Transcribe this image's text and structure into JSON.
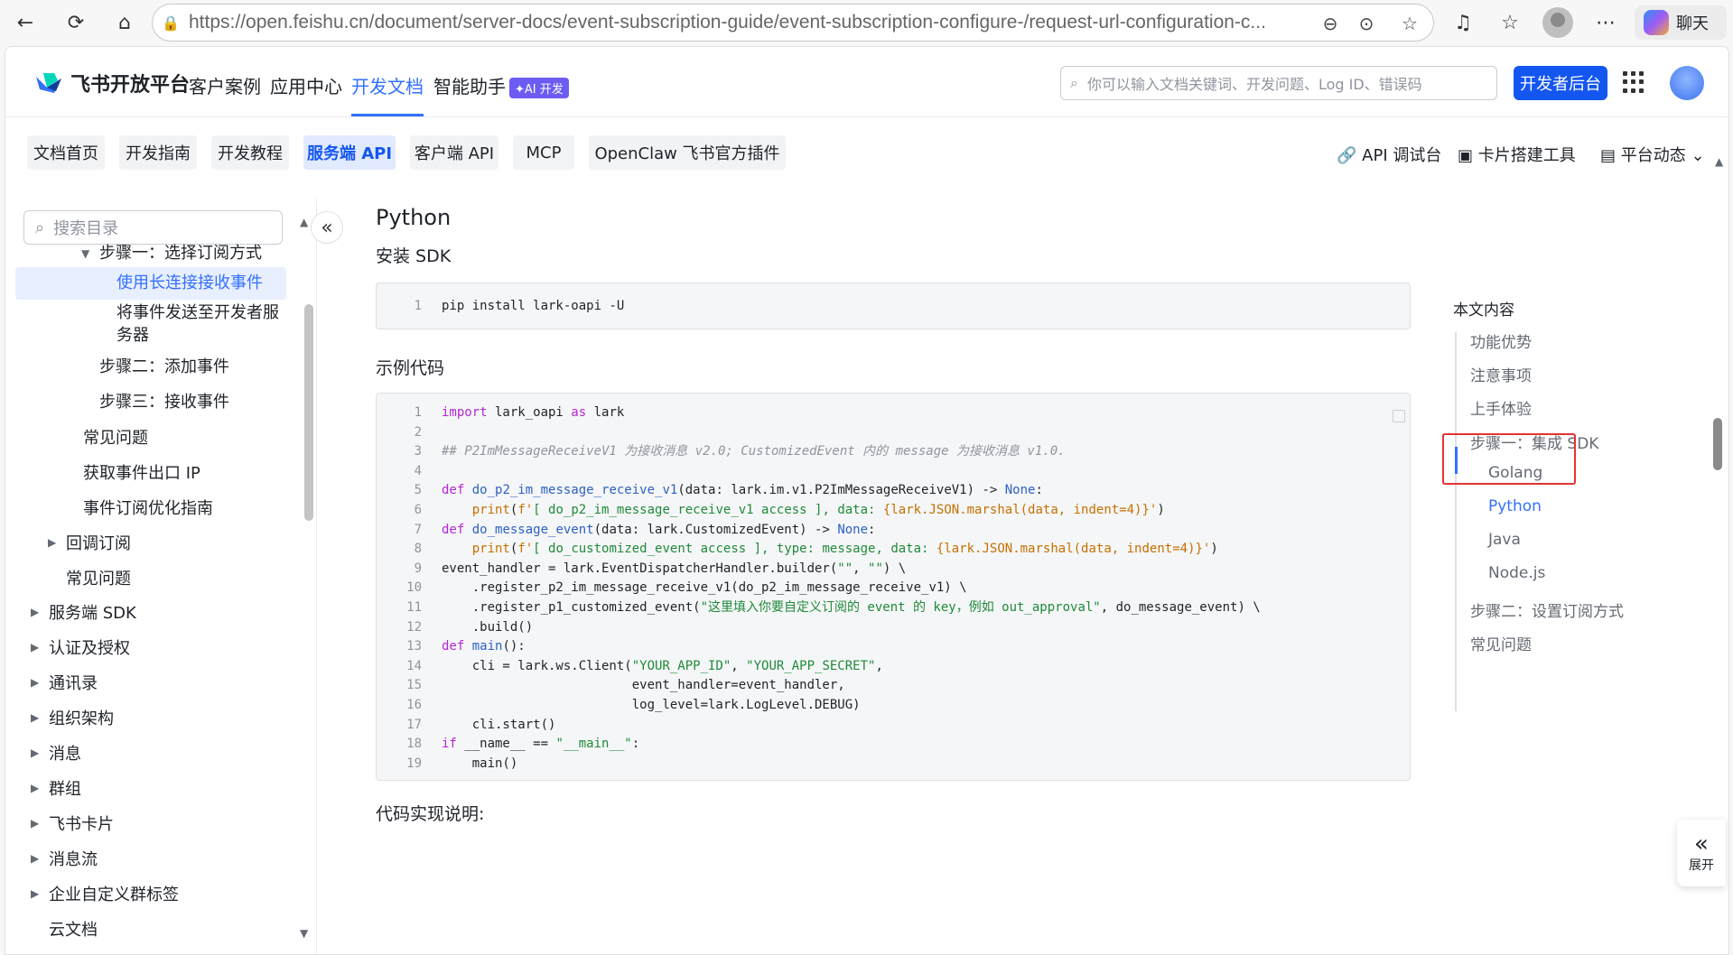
{
  "browser": {
    "url": "https://open.feishu.cn/document/server-docs/event-subscription-guide/event-subscription-configure-/request-url-configuration-c...",
    "chat_label": "聊天"
  },
  "topnav": {
    "brand": "飞书开放平台",
    "items": [
      {
        "label": "客户案例"
      },
      {
        "label": "应用中心"
      },
      {
        "label": "开发文档"
      },
      {
        "label": "智能助手"
      }
    ],
    "ai_badge": "✦AI 开发",
    "search_placeholder": "你可以输入文档关键词、开发问题、Log ID、错误码",
    "dev_button": "开发者后台"
  },
  "tabs": [
    {
      "label": "文档首页"
    },
    {
      "label": "开发指南"
    },
    {
      "label": "开发教程"
    },
    {
      "label": "服务端 API"
    },
    {
      "label": "客户端 API"
    },
    {
      "label": "MCP"
    },
    {
      "label": "OpenClaw 飞书官方插件"
    }
  ],
  "tools": {
    "api_debug": "API 调试台",
    "card_builder": "卡片搭建工具",
    "platform_news": "平台动态"
  },
  "sidebar": {
    "search_placeholder": "搜索目录",
    "items": [
      {
        "label": "步骤一：选择订阅方式"
      },
      {
        "label": "使用长连接接收事件"
      },
      {
        "label": "将事件发送至开发者服"
      },
      {
        "label": "务器"
      },
      {
        "label": "步骤二：添加事件"
      },
      {
        "label": "步骤三：接收事件"
      },
      {
        "label": "常见问题"
      },
      {
        "label": "获取事件出口 IP"
      },
      {
        "label": "事件订阅优化指南"
      },
      {
        "label": "回调订阅"
      },
      {
        "label": "常见问题"
      },
      {
        "label": "服务端 SDK"
      },
      {
        "label": "认证及授权"
      },
      {
        "label": "通讯录"
      },
      {
        "label": "组织架构"
      },
      {
        "label": "消息"
      },
      {
        "label": "群组"
      },
      {
        "label": "飞书卡片"
      },
      {
        "label": "消息流"
      },
      {
        "label": "企业自定义群标签"
      },
      {
        "label": "云文档"
      }
    ]
  },
  "content": {
    "heading": "Python",
    "install_heading": "安装 SDK",
    "install_code": [
      "pip install lark-oapi -U"
    ],
    "example_heading": "示例代码",
    "code_lines": [
      "import lark_oapi as lark",
      "",
      "## P2ImMessageReceiveV1 为接收消息 v2.0; CustomizedEvent 内的 message 为接收消息 v1.0.",
      "",
      "def do_p2_im_message_receive_v1(data: lark.im.v1.P2ImMessageReceiveV1) -> None:",
      "    print(f'[ do_p2_im_message_receive_v1 access ], data: {lark.JSON.marshal(data, indent=4)}')",
      "def do_message_event(data: lark.CustomizedEvent) -> None:",
      "    print(f'[ do_customized_event access ], type: message, data: {lark.JSON.marshal(data, indent=4)}')",
      "event_handler = lark.EventDispatcherHandler.builder(\"\", \"\") \\",
      "    .register_p2_im_message_receive_v1(do_p2_im_message_receive_v1) \\",
      "    .register_p1_customized_event(\"这里填入你要自定义订阅的 event 的 key，例如 out_approval\", do_message_event) \\",
      "    .build()",
      "def main():",
      "    cli = lark.ws.Client(\"YOUR_APP_ID\", \"YOUR_APP_SECRET\",",
      "                         event_handler=event_handler,",
      "                         log_level=lark.LogLevel.DEBUG)",
      "    cli.start()",
      "if __name__ == \"__main__\":",
      "    main()"
    ],
    "impl_heading": "代码实现说明:"
  },
  "toc": {
    "title": "本文内容",
    "items": [
      {
        "label": "功能优势"
      },
      {
        "label": "注意事项"
      },
      {
        "label": "上手体验"
      },
      {
        "label": "步骤一：集成 SDK"
      },
      {
        "label": "Golang"
      },
      {
        "label": "Python"
      },
      {
        "label": "Java"
      },
      {
        "label": "Node.js"
      },
      {
        "label": "步骤二：设置订阅方式"
      },
      {
        "label": "常见问题"
      }
    ]
  },
  "expand_label": "展开"
}
